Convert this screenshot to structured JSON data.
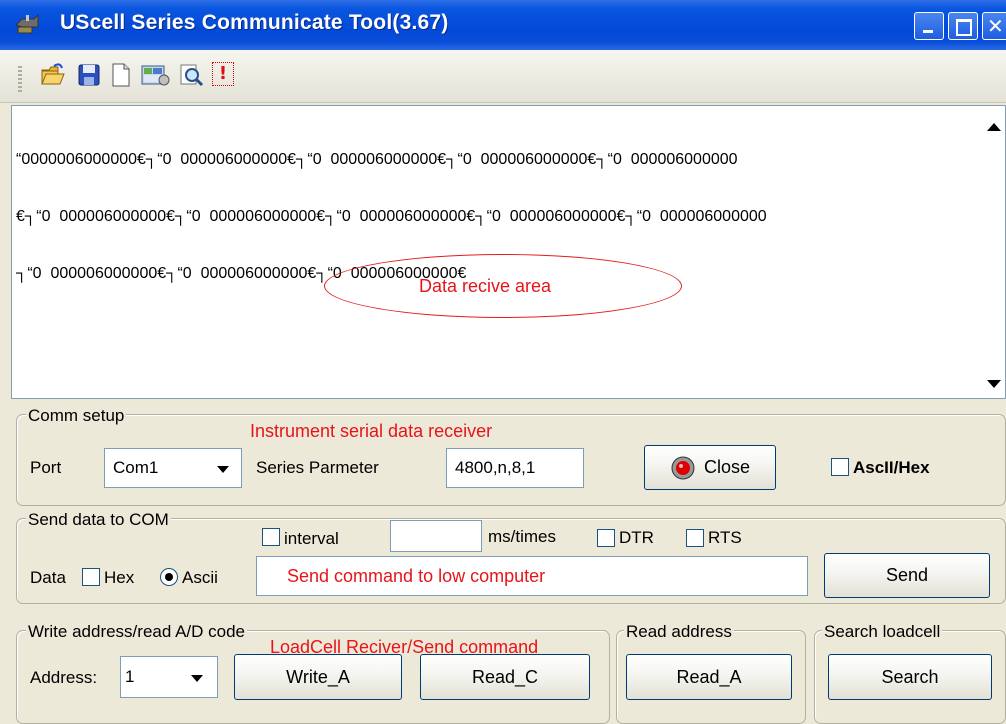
{
  "window": {
    "title": "UScell Series Communicate Tool(3.67)",
    "controls": [
      "minimize-icon",
      "maximize-icon",
      "close-icon"
    ]
  },
  "toolbar": {
    "buttons": [
      "open-folder-icon",
      "save-disk-icon",
      "new-document-icon",
      "settings-icon",
      "search-magnifier-icon",
      "alert-icon"
    ],
    "alert_glyph": "!"
  },
  "receive_area": {
    "lines": [
      "“0000006000000€┐“0  000006000000€┐“0  000006000000€┐“0  000006000000€┐“0  000006000000",
      "€┐“0  000006000000€┐“0  000006000000€┐“0  000006000000€┐“0  000006000000€┐“0  000006000000",
      "┐“0  000006000000€┐“0  000006000000€┐“0  000006000000€"
    ],
    "annotation": "Data recive area"
  },
  "comm_setup": {
    "legend": "Comm setup",
    "annotation": "Instrument serial data receiver",
    "port_label": "Port",
    "port_value": "Com1",
    "series_label": "Series Parmeter",
    "series_value": "4800,n,8,1",
    "close_button": "Close",
    "ascii_hex_label": "AscII/Hex",
    "ascii_hex_checked": false
  },
  "send_data": {
    "legend": "Send data to COM",
    "interval_label": "interval",
    "interval_checked": false,
    "interval_value": "",
    "ms_label": "ms/times",
    "dtr_label": "DTR",
    "dtr_checked": false,
    "rts_label": "RTS",
    "rts_checked": false,
    "data_label": "Data",
    "hex_label": "Hex",
    "hex_checked": false,
    "ascii_label": "Ascii",
    "ascii_selected": true,
    "command_annotation": "Send command to low computer",
    "send_button": "Send"
  },
  "write_address": {
    "legend": "Write address/read A/D code",
    "annotation": "LoadCell Reciver/Send command",
    "address_label": "Address:",
    "address_value": "1",
    "write_button": "Write_A",
    "read_c_button": "Read_C"
  },
  "read_address": {
    "legend": "Read address",
    "read_a_button": "Read_A"
  },
  "search_loadcell": {
    "legend": "Search loadcell",
    "search_button": "Search"
  },
  "colors": {
    "title_bar": "#0349d8",
    "window_bg": "#ece9d8",
    "annotation_red": "#e8141a"
  }
}
